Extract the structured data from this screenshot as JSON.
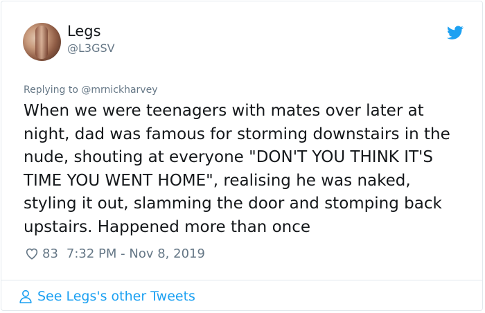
{
  "tweet": {
    "author_name": "Legs",
    "author_handle": "@L3GSV",
    "replying_to": "Replying to @mrnickharvey",
    "text": "When we were teenagers with mates over later at night, dad was famous for storming downstairs in the nude, shouting at everyone \"DON'T YOU THINK IT'S TIME YOU WENT HOME\", realising he was naked, styling it out, slamming the door and stomping back upstairs. Happened more than once",
    "likes": "83",
    "timestamp": "7:32 PM - Nov 8, 2019",
    "see_more": "See Legs's other Tweets"
  },
  "icons": {
    "brand": "twitter-bird-icon",
    "like": "heart-icon",
    "profile": "person-icon"
  },
  "colors": {
    "accent": "#1da1f2",
    "text": "#14171a",
    "muted": "#657786",
    "border": "#e1e8ed"
  }
}
